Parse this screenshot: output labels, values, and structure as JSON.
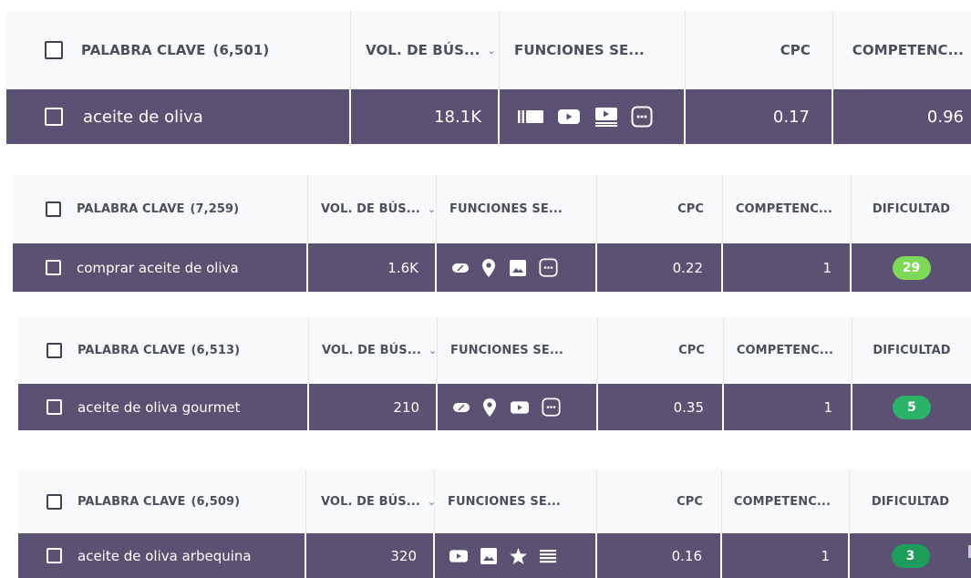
{
  "colors": {
    "header_bg": "#f8f9fb",
    "row_bg": "#5b5172",
    "badge_light_green": "#7ed957",
    "badge_green": "#2cb36a",
    "badge_dark_green": "#1e9c5a"
  },
  "tables": [
    {
      "header": {
        "keyword": "PALABRA CLAVE",
        "keyword_count": "(6,501)",
        "volume": "VOL. DE BÚS...",
        "serp": "FUNCIONES SE...",
        "cpc": "CPC",
        "competition": "COMPETENC..."
      },
      "row": {
        "keyword": "aceite de oliva",
        "volume": "18.1K",
        "serp_icons": [
          "featured-snippet-icon",
          "video-icon",
          "video-carousel-icon",
          "more-icon"
        ],
        "cpc": "0.17",
        "competition": "0.96"
      }
    },
    {
      "header": {
        "keyword": "PALABRA CLAVE",
        "keyword_count": "(7,259)",
        "volume": "VOL. DE BÚS...",
        "serp": "FUNCIONES SE...",
        "cpc": "CPC",
        "competition": "COMPETENC...",
        "difficulty": "DIFICULTAD"
      },
      "row": {
        "keyword": "comprar aceite de oliva",
        "volume": "1.6K",
        "serp_icons": [
          "ads-icon",
          "local-pack-icon",
          "image-pack-icon",
          "more-icon"
        ],
        "cpc": "0.22",
        "competition": "1",
        "difficulty": "29",
        "difficulty_color": "#7ed957"
      }
    },
    {
      "header": {
        "keyword": "PALABRA CLAVE",
        "keyword_count": "(6,513)",
        "volume": "VOL. DE BÚS...",
        "serp": "FUNCIONES SE...",
        "cpc": "CPC",
        "competition": "COMPETENC...",
        "difficulty": "DIFICULTAD"
      },
      "row": {
        "keyword": "aceite de oliva gourmet",
        "volume": "210",
        "serp_icons": [
          "ads-icon",
          "local-pack-icon",
          "video-icon",
          "more-icon"
        ],
        "cpc": "0.35",
        "competition": "1",
        "difficulty": "5",
        "difficulty_color": "#2cb36a"
      }
    },
    {
      "header": {
        "keyword": "PALABRA CLAVE",
        "keyword_count": "(6,509)",
        "volume": "VOL. DE BÚS...",
        "serp": "FUNCIONES SE...",
        "cpc": "CPC",
        "competition": "COMPETENC...",
        "difficulty": "DIFICULTAD"
      },
      "row": {
        "keyword": "aceite de oliva arbequina",
        "volume": "320",
        "serp_icons": [
          "video-icon",
          "image-pack-icon",
          "reviews-icon",
          "sitelinks-icon"
        ],
        "cpc": "0.16",
        "competition": "1",
        "difficulty": "3",
        "difficulty_color": "#1e9c5a"
      }
    }
  ]
}
